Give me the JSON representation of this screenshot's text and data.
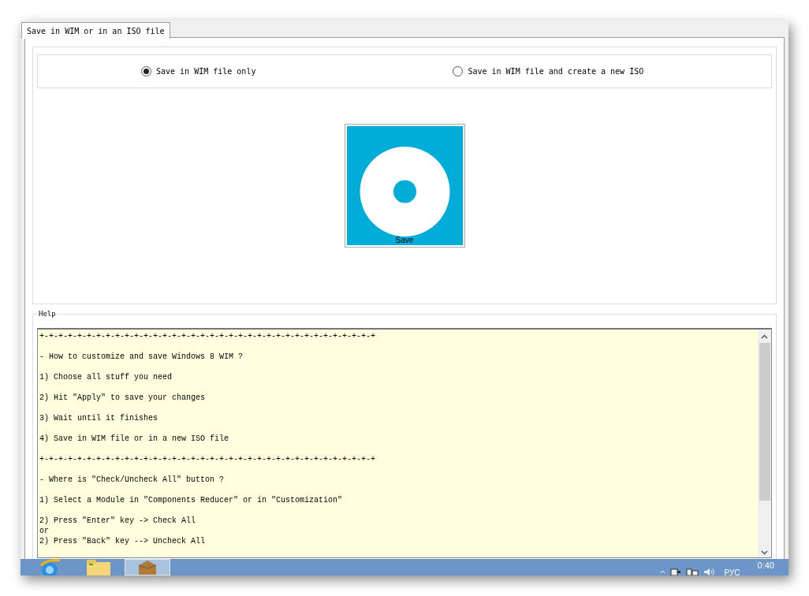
{
  "tabs": [
    {
      "label": "Save in WIM or in an ISO file",
      "selected": true
    }
  ],
  "save_mode": [
    {
      "label": "Save in WIM file only",
      "selected": true
    },
    {
      "label": "Save in WIM file and create a new ISO",
      "selected": false
    }
  ],
  "save_button": {
    "label": "Save"
  },
  "help": {
    "title": "Help",
    "blocks": [
      [
        "+-+-+-+-+-+-+-+-+-+-+-+-+-+-+-+-+-+-+-+-+-+-+-+-+-+-+-+-+-+-+-+-+-+-+-+"
      ],
      [
        "- How to customize and save Windows 8 WIM ?"
      ],
      [
        "1) Choose all stuff you need"
      ],
      [
        "2) Hit \"Apply\" to save your changes"
      ],
      [
        "3) Wait until it finishes"
      ],
      [
        "4) Save in WIM file or in a new ISO file"
      ],
      [
        "+-+-+-+-+-+-+-+-+-+-+-+-+-+-+-+-+-+-+-+-+-+-+-+-+-+-+-+-+-+-+-+-+-+-+-+"
      ],
      [
        "- Where is \"Check/Uncheck All\" button ?"
      ],
      [
        "1) Select a Module in \"Components Reducer\" or in \"Customization\""
      ],
      [
        "2) Press \"Enter\" key -> Check All",
        "or",
        "2) Press \"Back\" key --> Uncheck All"
      ]
    ]
  },
  "taskbar": {
    "apps": [
      {
        "kind": "browser",
        "selected": false
      },
      {
        "kind": "folder",
        "selected": false
      },
      {
        "kind": "box",
        "selected": true
      }
    ],
    "language": "РУС",
    "time": "0:40"
  }
}
